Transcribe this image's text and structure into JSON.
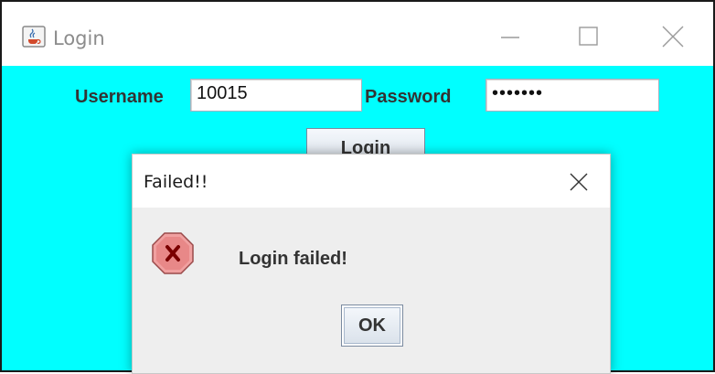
{
  "window": {
    "title": "Login",
    "icon": "java-cup-icon",
    "background_color": "#00ffff",
    "controls": [
      "minimize-icon",
      "maximize-icon",
      "close-icon"
    ]
  },
  "form": {
    "username_label": "Username",
    "username_value": "10015",
    "password_label": "Password",
    "password_value": "•••••••",
    "login_button": "Login"
  },
  "dialog": {
    "title": "Failed!!",
    "icon": "error-icon",
    "message": "Login failed!",
    "ok_button": "OK"
  }
}
